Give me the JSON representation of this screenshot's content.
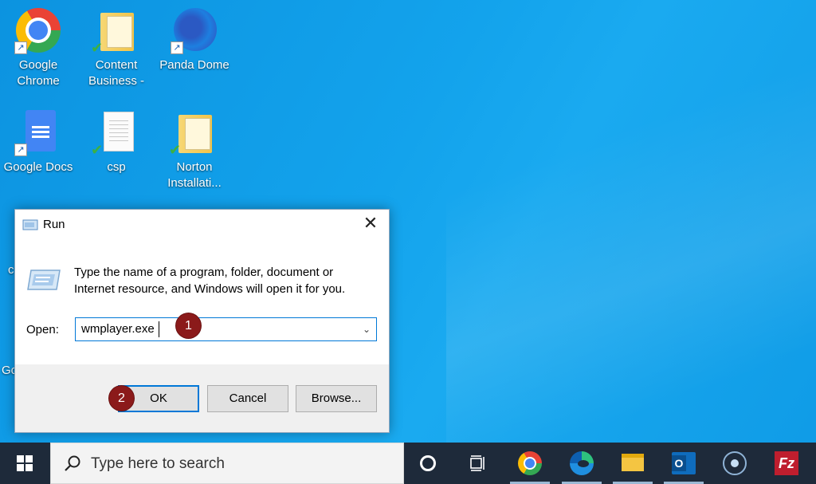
{
  "desktop": {
    "icons": [
      {
        "label": "Google Chrome"
      },
      {
        "label": "Content Business -"
      },
      {
        "label": "Panda Dome"
      },
      {
        "label": "Google Docs"
      },
      {
        "label": "csp"
      },
      {
        "label": "Norton Installati..."
      }
    ],
    "partial_left_labels": [
      "c",
      "Go"
    ]
  },
  "run_dialog": {
    "title": "Run",
    "close_glyph": "✕",
    "description": "Type the name of a program, folder, document or Internet resource, and Windows will open it for you.",
    "open_label": "Open:",
    "open_value": "wmplayer.exe",
    "buttons": {
      "ok": "OK",
      "cancel": "Cancel",
      "browse": "Browse..."
    }
  },
  "annotations": {
    "step1": "1",
    "step2": "2"
  },
  "taskbar": {
    "search_placeholder": "Type here to search",
    "pinned": [
      "cortana-icon",
      "task-view-icon",
      "chrome-icon",
      "edge-icon",
      "file-explorer-icon",
      "outlook-icon",
      "circle-app-icon",
      "filezilla-icon"
    ],
    "filezilla_text": "Fz"
  },
  "colors": {
    "accent": "#0078d7",
    "badge": "#8b1a1a",
    "taskbar": "#1e2a3a",
    "desktop": "#13a3ec"
  }
}
